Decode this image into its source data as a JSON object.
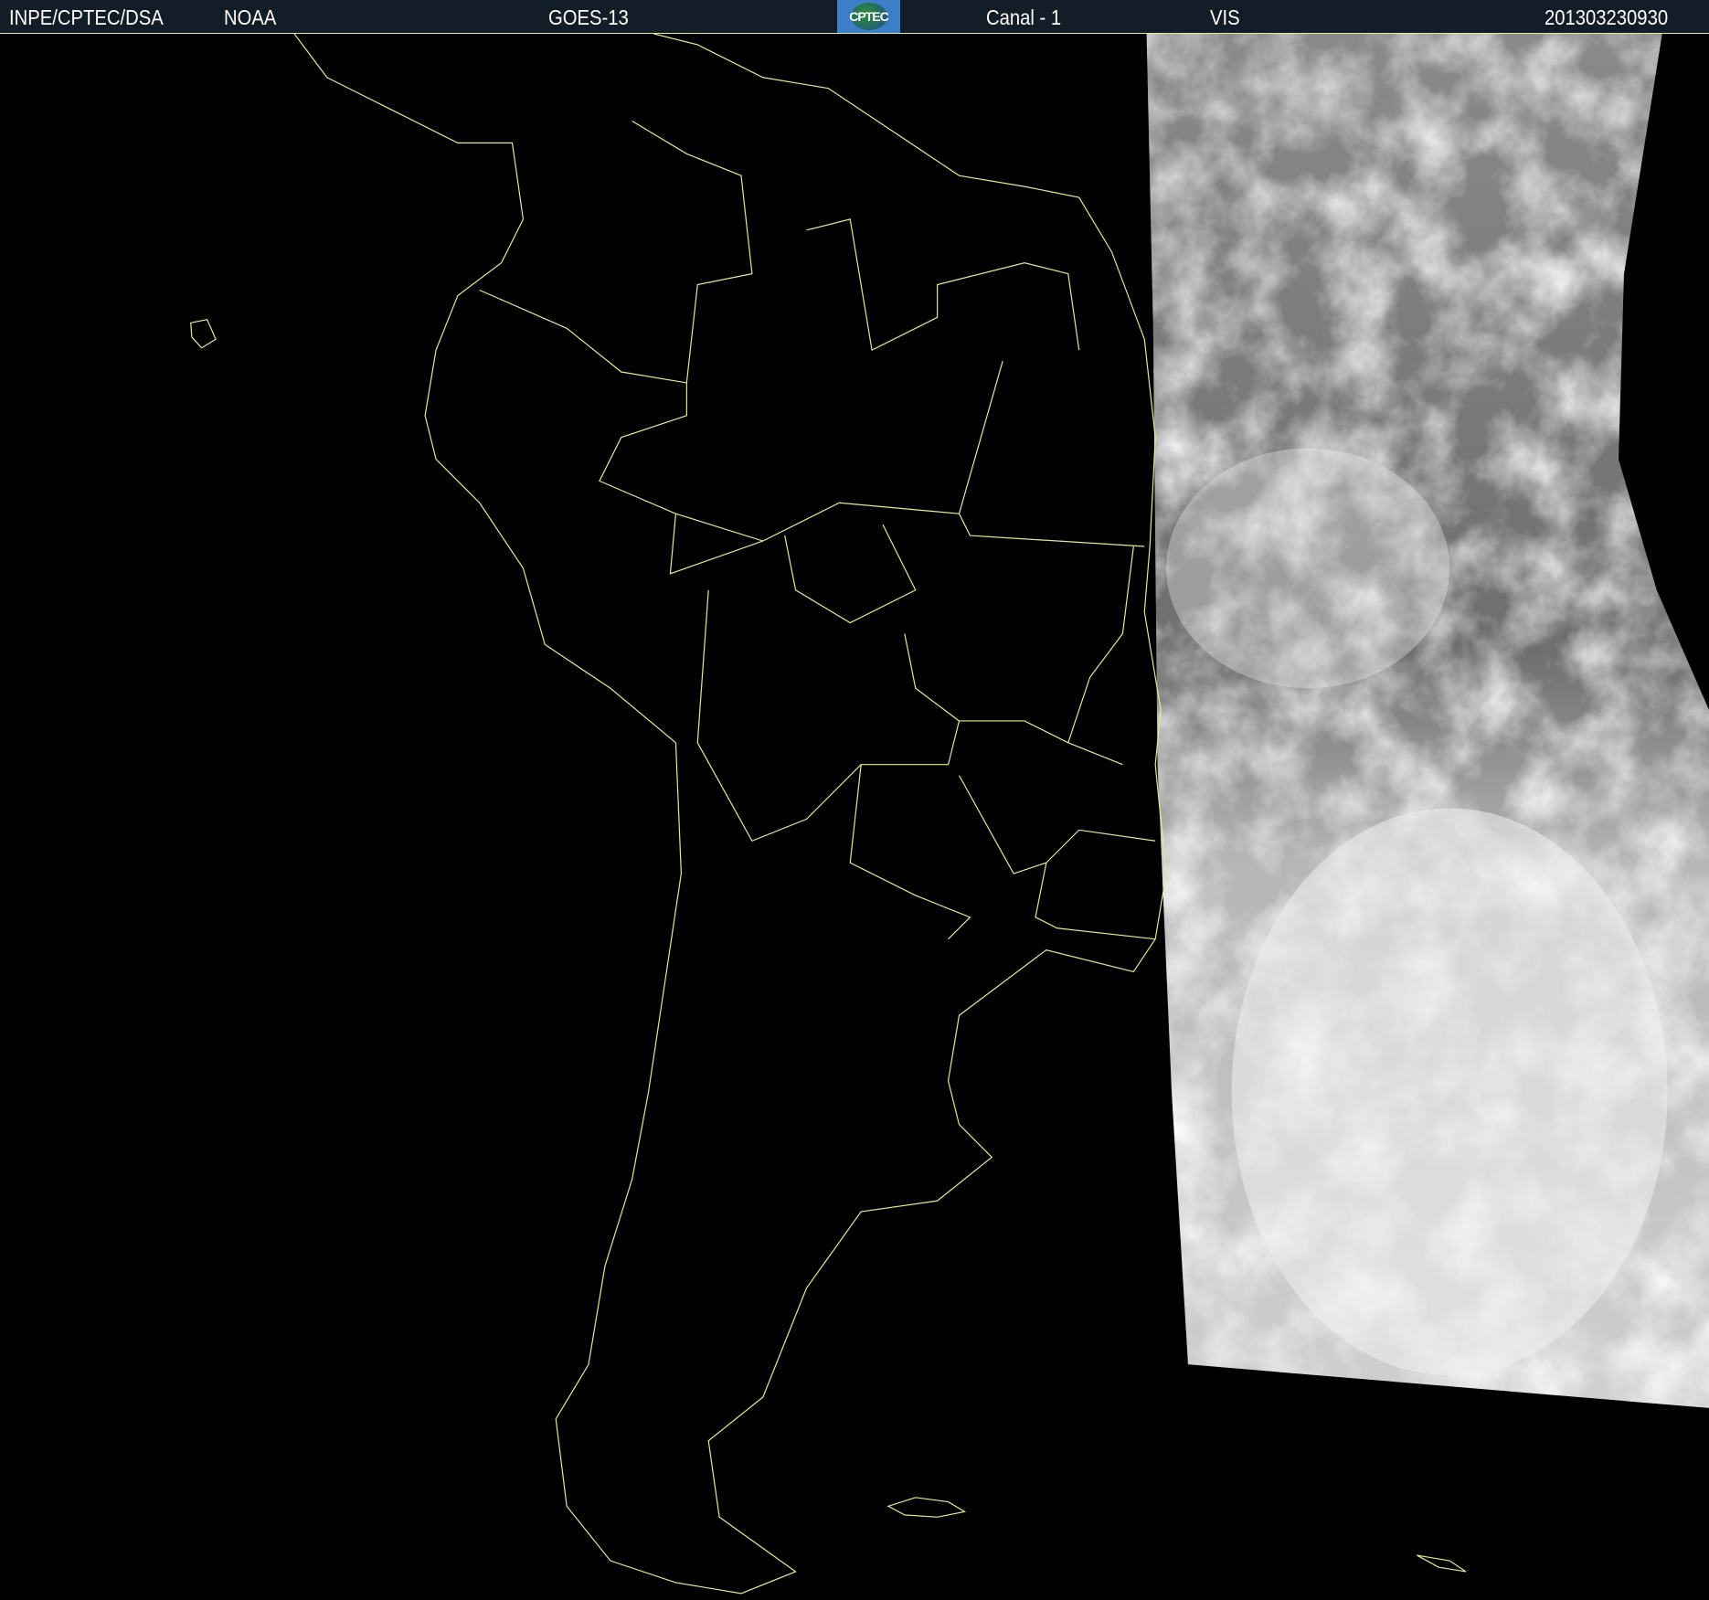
{
  "header": {
    "source": "INPE/CPTEC/DSA",
    "agency": "NOAA",
    "satellite": "GOES-13",
    "logo_text": "CPTEC",
    "channel": "Canal - 1",
    "band": "VIS",
    "timestamp": "201303230930"
  },
  "colors": {
    "header_bg": "#121d27",
    "outline": "#e8e89a",
    "background": "#000000"
  }
}
